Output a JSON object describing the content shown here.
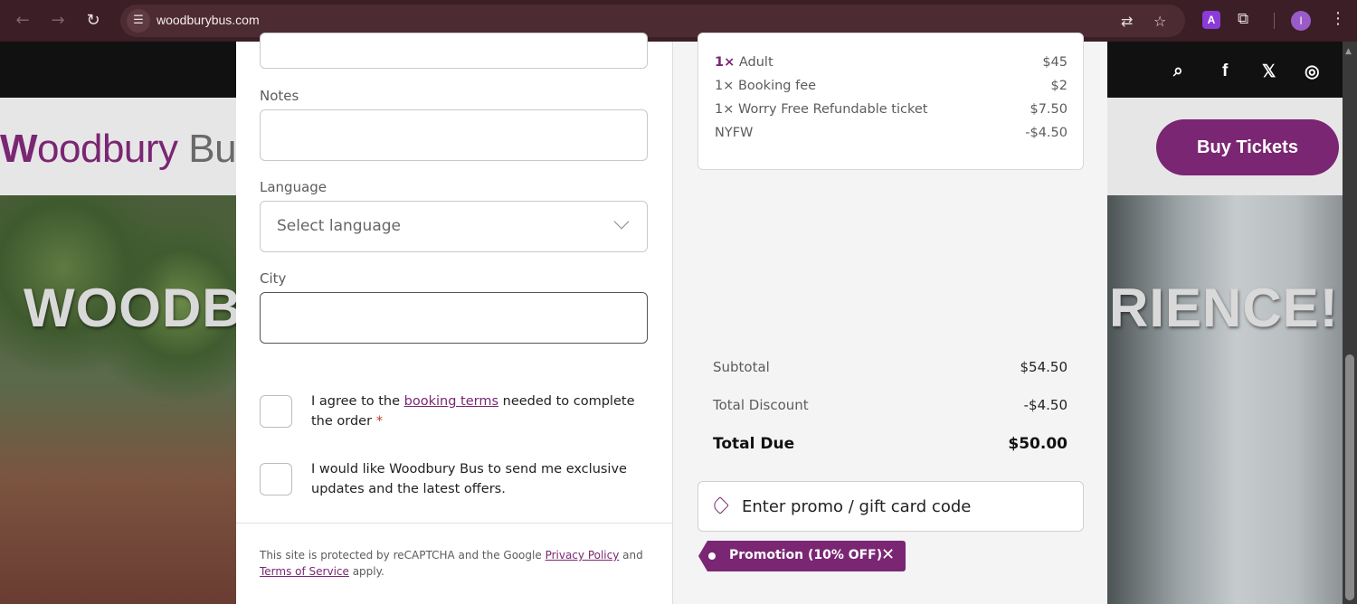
{
  "browser": {
    "url": "woodburybus.com",
    "extension_label": "A",
    "profile_initial": "I"
  },
  "site": {
    "logo_first": "W",
    "logo_rest": "oodbury",
    "logo_second": " Bu",
    "buy_tickets": "Buy Tickets",
    "hero_left": "WOODB",
    "hero_right": "RIENCE!"
  },
  "form": {
    "notes_label": "Notes",
    "language_label": "Language",
    "language_value": "Select language",
    "city_label": "City",
    "terms_text_before": "I agree to the ",
    "terms_link": "booking terms",
    "terms_text_after": " needed to complete the order ",
    "required_mark": "*",
    "offers_text": "I would like Woodbury Bus to send me exclusive updates and the latest offers.",
    "recaptcha_before": "This site is protected by reCAPTCHA and the Google ",
    "privacy_link": "Privacy Policy",
    "recaptcha_and": " and ",
    "tos_link": "Terms of Service",
    "recaptcha_after": " apply."
  },
  "summary": {
    "items": [
      {
        "qty": "1×",
        "name": " Adult",
        "amount": "$45"
      },
      {
        "qty": "",
        "name": "1× Booking fee",
        "amount": "$2"
      },
      {
        "qty": "",
        "name": "1× Worry Free Refundable ticket",
        "amount": "$7.50"
      },
      {
        "qty": "",
        "name": "NYFW",
        "amount": "-$4.50"
      }
    ],
    "subtotal_label": "Subtotal",
    "subtotal_value": "$54.50",
    "discount_label": "Total Discount",
    "discount_value": "-$4.50",
    "due_label": "Total Due",
    "due_value": "$50.00",
    "promo_placeholder": "Enter promo / gift card code",
    "promo_applied": "Promotion (10% OFF)"
  },
  "colors": {
    "brand": "#7a2673",
    "chrome": "#3c1e26"
  }
}
